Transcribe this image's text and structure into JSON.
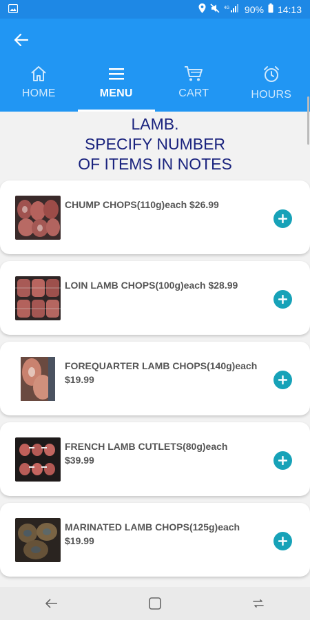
{
  "status_bar": {
    "battery": "90%",
    "time": "14:13",
    "left_icons": [
      "image-icon"
    ],
    "right_icons": [
      "location-icon",
      "mute-icon",
      "signal-icon",
      "battery-icon"
    ]
  },
  "app_bar": {
    "back_icon": "arrow-left-icon",
    "tabs": [
      {
        "label": "HOME",
        "icon": "home-icon",
        "active": false
      },
      {
        "label": "MENU",
        "icon": "menu-icon",
        "active": true
      },
      {
        "label": "CART",
        "icon": "cart-icon",
        "active": false
      },
      {
        "label": "HOURS",
        "icon": "alarm-clock-icon",
        "active": false
      }
    ]
  },
  "heading": {
    "line1": "LAMB.",
    "line2": "SPECIFY NUMBER",
    "line3": "OF ITEMS IN NOTES"
  },
  "products": [
    {
      "title": "CHUMP CHOPS(110g)each $26.99"
    },
    {
      "title": "LOIN LAMB CHOPS(100g)each $28.99"
    },
    {
      "title": "FOREQUARTER LAMB CHOPS(140g)each $19.99"
    },
    {
      "title": "FRENCH LAMB CUTLETS(80g)each $39.99"
    },
    {
      "title": "MARINATED LAMB CHOPS(125g)each $19.99"
    }
  ],
  "colors": {
    "status_bar": "#1e88e5",
    "app_bar": "#2196f3",
    "heading": "#1a237e",
    "add_button": "#17a2b8"
  },
  "nav_bar": {
    "buttons": [
      "back-nav-icon",
      "home-nav-icon",
      "recents-nav-icon"
    ]
  }
}
